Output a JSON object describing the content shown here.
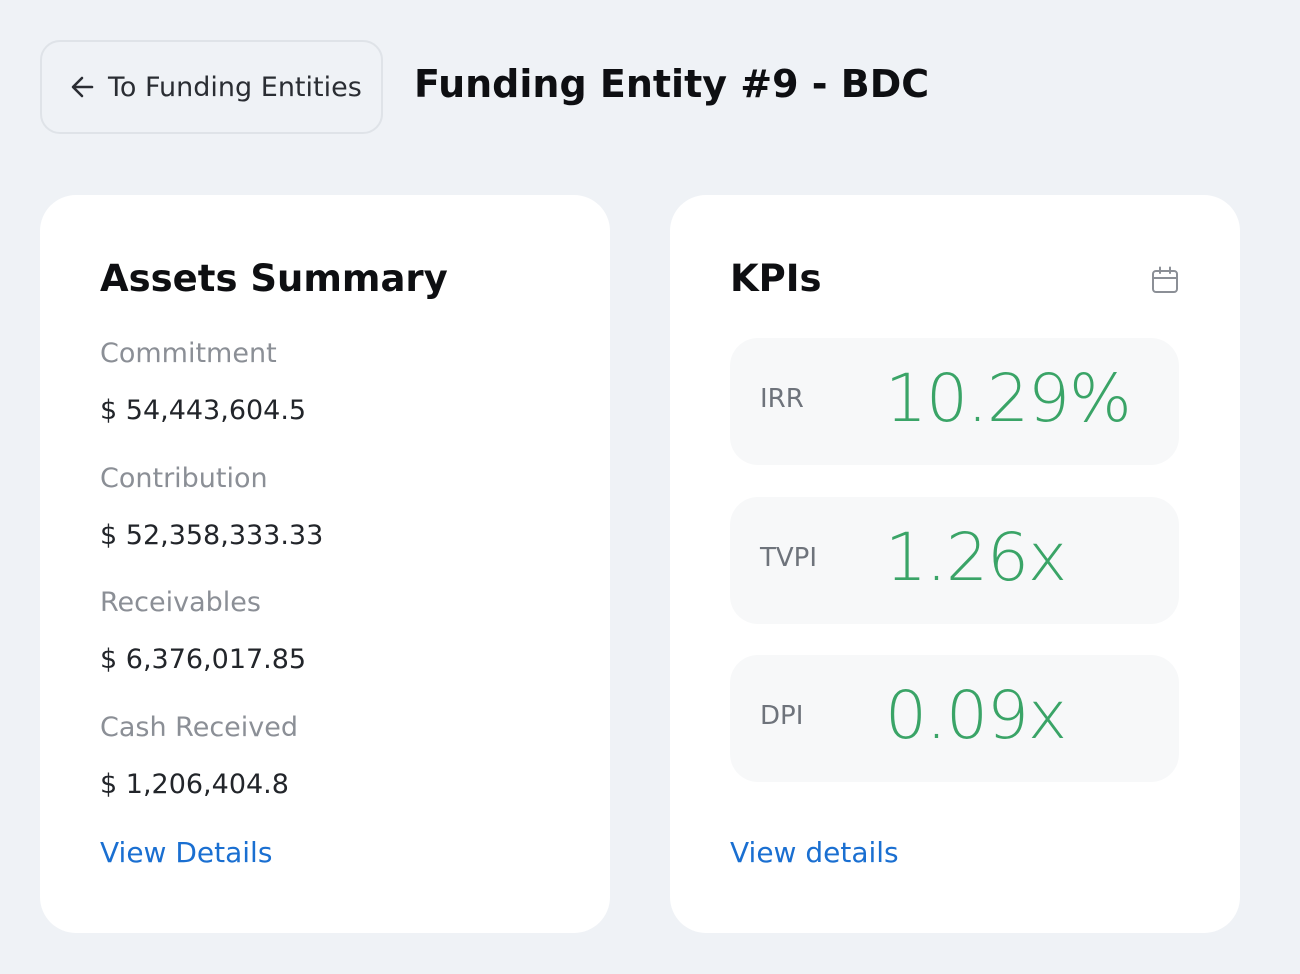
{
  "header": {
    "back_label": "To Funding Entities",
    "title": "Funding Entity #9 - BDC"
  },
  "assets": {
    "title": "Assets Summary",
    "fields": [
      {
        "label": "Commitment",
        "value": "$ 54,443,604.5"
      },
      {
        "label": "Contribution",
        "value": "$ 52,358,333.33"
      },
      {
        "label": "Receivables",
        "value": "$ 6,376,017.85"
      },
      {
        "label": "Cash Received",
        "value": "$ 1,206,404.8"
      }
    ],
    "link_label": "View Details"
  },
  "kpis": {
    "title": "KPIs",
    "items": [
      {
        "label": "IRR",
        "value": "10.29%"
      },
      {
        "label": "TVPI",
        "value": "1.26x"
      },
      {
        "label": "DPI",
        "value": "0.09x"
      }
    ],
    "link_label": "View details",
    "calendar_icon": "calendar-icon"
  },
  "colors": {
    "background": "#eff2f6",
    "card": "#ffffff",
    "kpi_value": "#3aa467",
    "link": "#1a6fd1",
    "muted_label": "#8b8f96"
  }
}
